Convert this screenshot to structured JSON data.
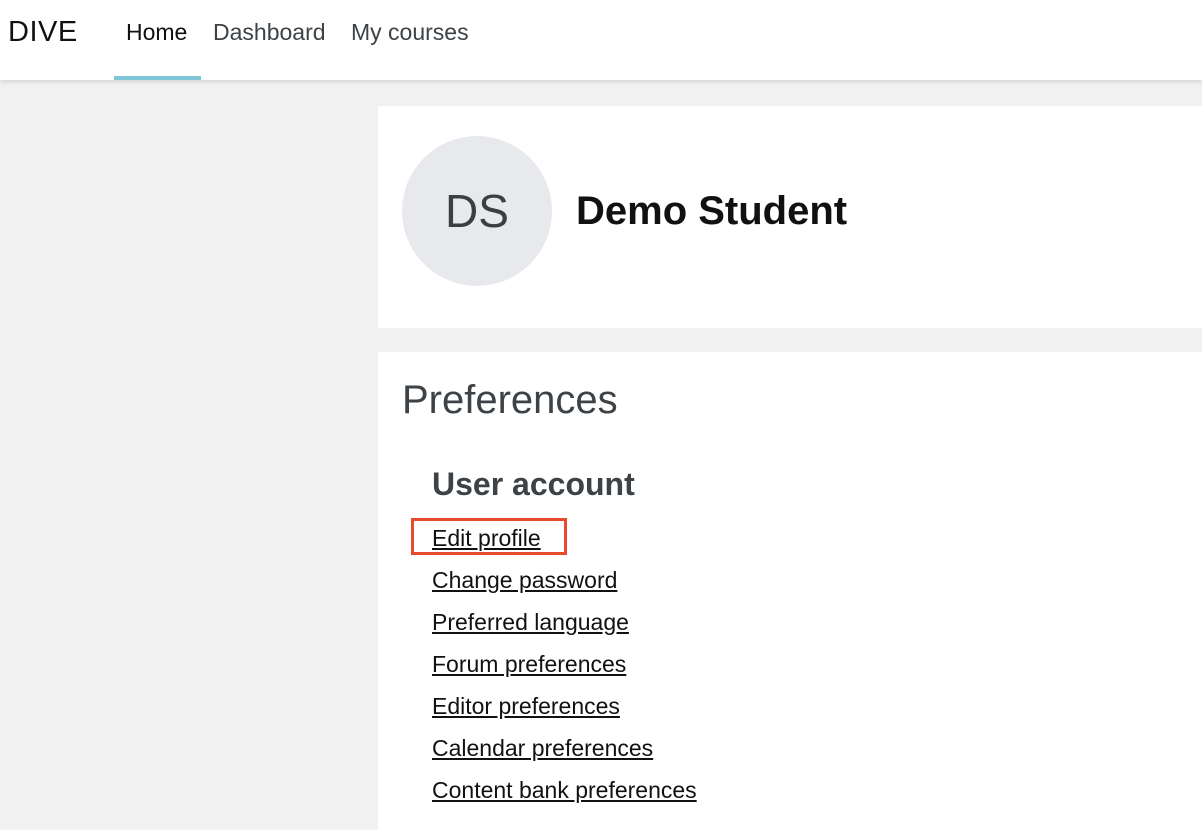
{
  "navbar": {
    "brand": "DIVE",
    "items": [
      {
        "label": "Home",
        "active": true
      },
      {
        "label": "Dashboard",
        "active": false
      },
      {
        "label": "My courses",
        "active": false
      }
    ],
    "active_color": "#7fc6d6"
  },
  "profile": {
    "initials": "DS",
    "name": "Demo Student"
  },
  "preferences": {
    "title": "Preferences",
    "section_title": "User account",
    "links": [
      {
        "label": "Edit profile",
        "highlighted": true
      },
      {
        "label": "Change password"
      },
      {
        "label": "Preferred language"
      },
      {
        "label": "Forum preferences"
      },
      {
        "label": "Editor preferences"
      },
      {
        "label": "Calendar preferences"
      },
      {
        "label": "Content bank preferences"
      }
    ],
    "highlight_color": "#e54b2c"
  }
}
